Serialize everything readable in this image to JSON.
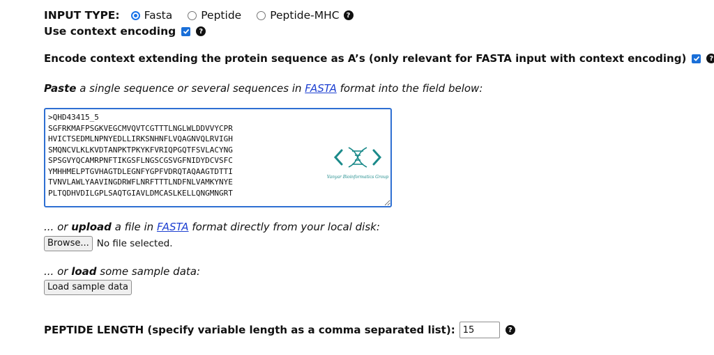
{
  "input_type": {
    "label": "INPUT TYPE:",
    "options": [
      "Fasta",
      "Peptide",
      "Peptide-MHC"
    ],
    "selected": "Fasta"
  },
  "context_encoding": {
    "label": "Use context encoding",
    "checked": true
  },
  "encode_context": {
    "label": "Encode context extending the protein sequence as A’s (only relevant for FASTA input with context encoding)",
    "checked": true
  },
  "paste_instruction": {
    "bold": "Paste",
    "mid": " a single sequence or several sequences in ",
    "link": "FASTA",
    "end": " format into the field below:"
  },
  "fasta_textarea": {
    "value": ">QHD43415_5\nSGFRKMAFPSGKVEGCMVQVTCGTTTLNGLWLDDVVYCPR\nHVICTSEDMLNPNYEDLLIRKSNHNFLVQAGNVQLRVIGH\nSMQNCVLKLKVDTANPKTPKYKFVRIQPGQTFSVLACYNG\nSPSGVYQCAMRPNFTIKGSFLNGSCGSVGFNIDYDCVSFC\nYMHHMELPTGVHAGTDLEGNFYGPFVDRQTAQAAGTDTTI\nTVNVLAWLYAAVINGDRWFLNRFTTTLNDFNLVAMKYNYE\nPLTQDHVDILGPLSAQTGIAVLDMCASLKELLQNGMNGRT"
  },
  "watermark": {
    "text": "Vanyar Bioinformatics Group",
    "color": "#1b8a8a"
  },
  "upload_instruction": {
    "pre": "... or ",
    "bold": "upload",
    "mid": " a file in ",
    "link": "FASTA",
    "end": " format directly from your local disk:"
  },
  "file_input": {
    "button_label": "Browse...",
    "status": "No file selected."
  },
  "load_instruction": {
    "pre": "... or ",
    "bold": "load",
    "end": " some sample data:"
  },
  "load_sample_button": "Load sample data",
  "peptide_length": {
    "label": "PEPTIDE LENGTH (specify variable length as a comma separated list):",
    "value": "15"
  },
  "help_glyph": "?",
  "icons": [
    "help-icon",
    "check-icon",
    "dna-logo-icon"
  ],
  "colors": {
    "accent": "#1a6fd8",
    "link": "#1c3fd1",
    "watermark": "#1b8a8a"
  }
}
